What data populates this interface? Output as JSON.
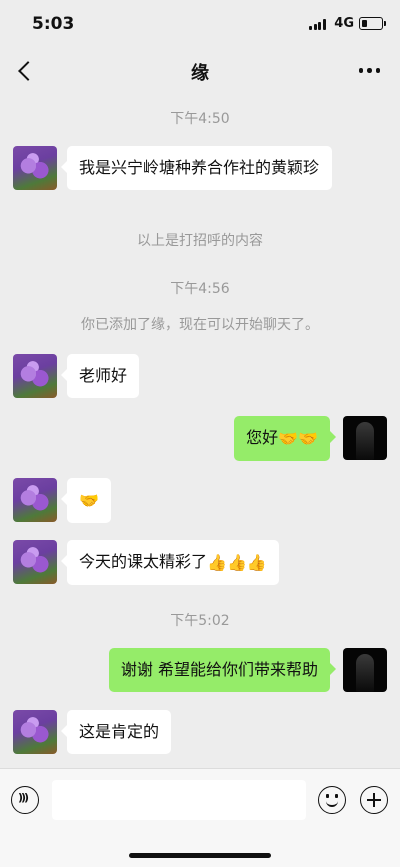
{
  "status_bar": {
    "time": "5:03",
    "network": "4G"
  },
  "header": {
    "title": "缘"
  },
  "messages": {
    "t1": "下午4:50",
    "m1": "我是兴宁岭塘种养合作社的黄颖珍",
    "note1": "以上是打招呼的内容",
    "t2": "下午4:56",
    "note2": "你已添加了缘，现在可以开始聊天了。",
    "m2": "老师好",
    "m3": "您好",
    "m3_emoji": "🤝🤝",
    "m4_emoji": "🤝",
    "m5": "今天的课太精彩了",
    "m5_emoji": "👍👍👍",
    "t3": "下午5:02",
    "m6": "谢谢 希望能给你们带来帮助",
    "m7": "这是肯定的"
  },
  "input": {
    "placeholder": ""
  },
  "colors": {
    "sent_bubble": "#95ec69",
    "received_bubble": "#ffffff",
    "background": "#ededed"
  },
  "icons": [
    "back-icon",
    "more-icon",
    "voice-icon",
    "emoji-icon",
    "plus-icon"
  ]
}
